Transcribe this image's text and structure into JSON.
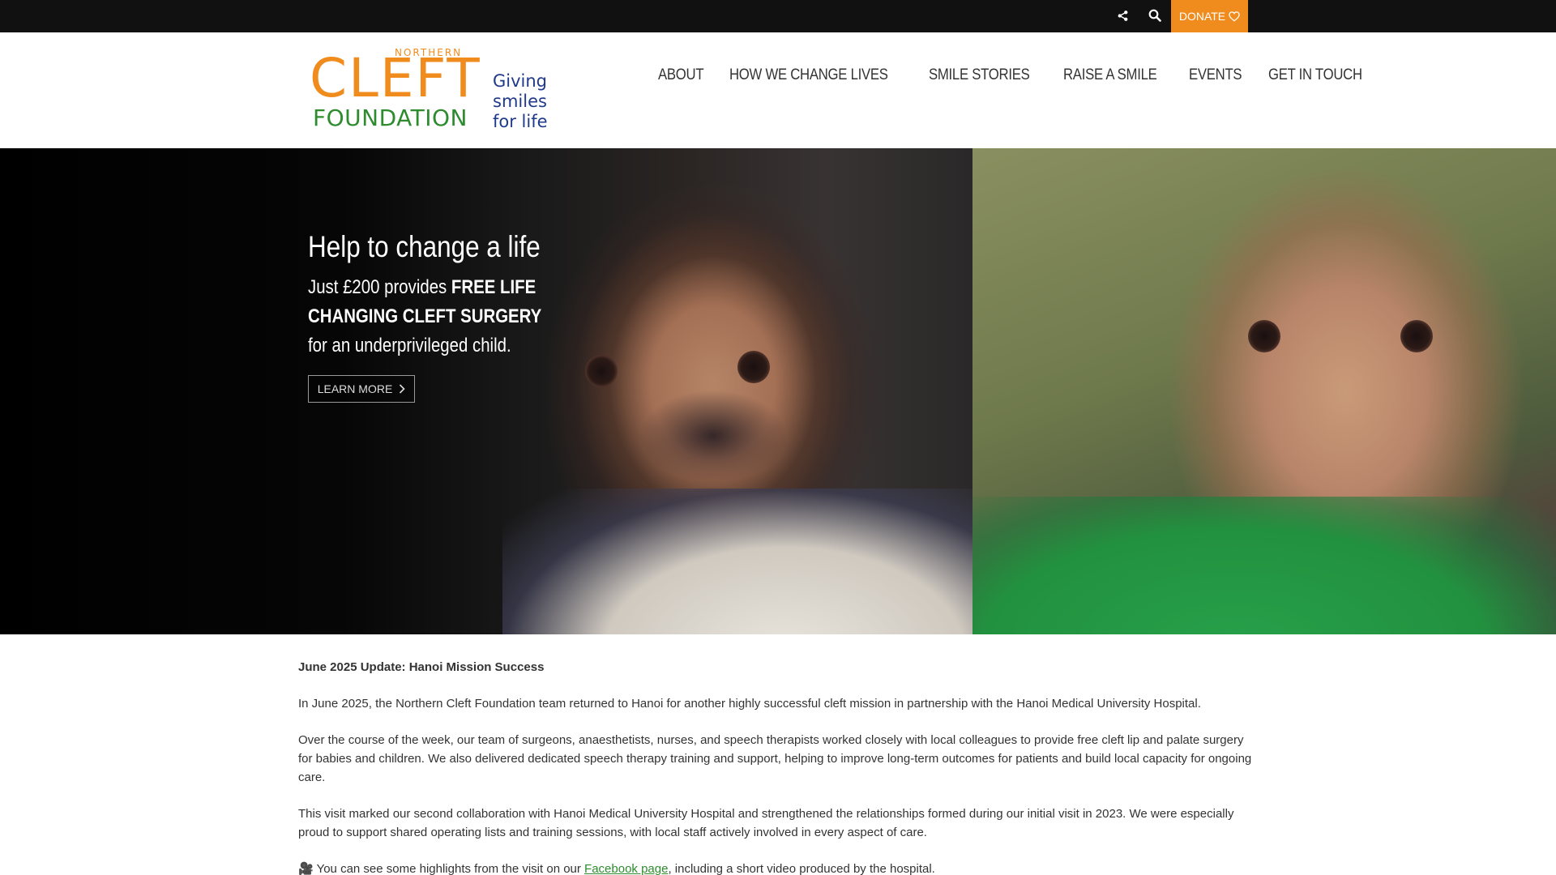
{
  "topbar": {
    "share_icon": "share-icon",
    "search_icon": "search-icon",
    "donate_label": "DONATE",
    "donate_icon": "heart-icon",
    "accent_color": "#f08c1d"
  },
  "logo": {
    "northern": "NORTHERN",
    "cleft": "CLEFT",
    "foundation": "FOUNDATION",
    "tagline_1": "Giving",
    "tagline_2": "smiles",
    "tagline_3": "for life"
  },
  "nav": {
    "items": [
      "ABOUT",
      "HOW WE CHANGE LIVES",
      "SMILE STORIES",
      "RAISE A SMILE",
      "EVENTS",
      "GET IN TOUCH"
    ]
  },
  "hero": {
    "title": "Help to change a life",
    "body_prefix": "Just £200 provides ",
    "body_bold": "FREE LIFE CHANGING CLEFT SURGERY",
    "body_suffix": "for an underprivileged child.",
    "cta_label": "LEARN MORE"
  },
  "article": {
    "heading": "June 2025 Update: Hanoi Mission Success",
    "p1": "In June 2025, the Northern Cleft Foundation team returned to Hanoi for another highly successful cleft mission in partnership with the Hanoi Medical University Hospital.",
    "p2": "Over the course of the week, our team of surgeons, anaesthetists, nurses, and speech therapists worked closely with local colleagues to provide free cleft lip and palate surgery for babies and children. We also delivered dedicated speech therapy training and support, helping to improve long-term outcomes for patients and build local capacity for ongoing care.",
    "p3": "This visit marked our second collaboration with Hanoi Medical University Hospital and strengthened the relationships formed during our initial visit in 2023. We were especially proud to support shared operating lists and training sessions, with local staff actively involved in every aspect of care.",
    "p4_emoji": "🎥",
    "p4_prefix": " You can see some highlights from the visit on our ",
    "p4_link": "Facebook page",
    "p4_suffix": ", including a short video produced by the hospital."
  }
}
